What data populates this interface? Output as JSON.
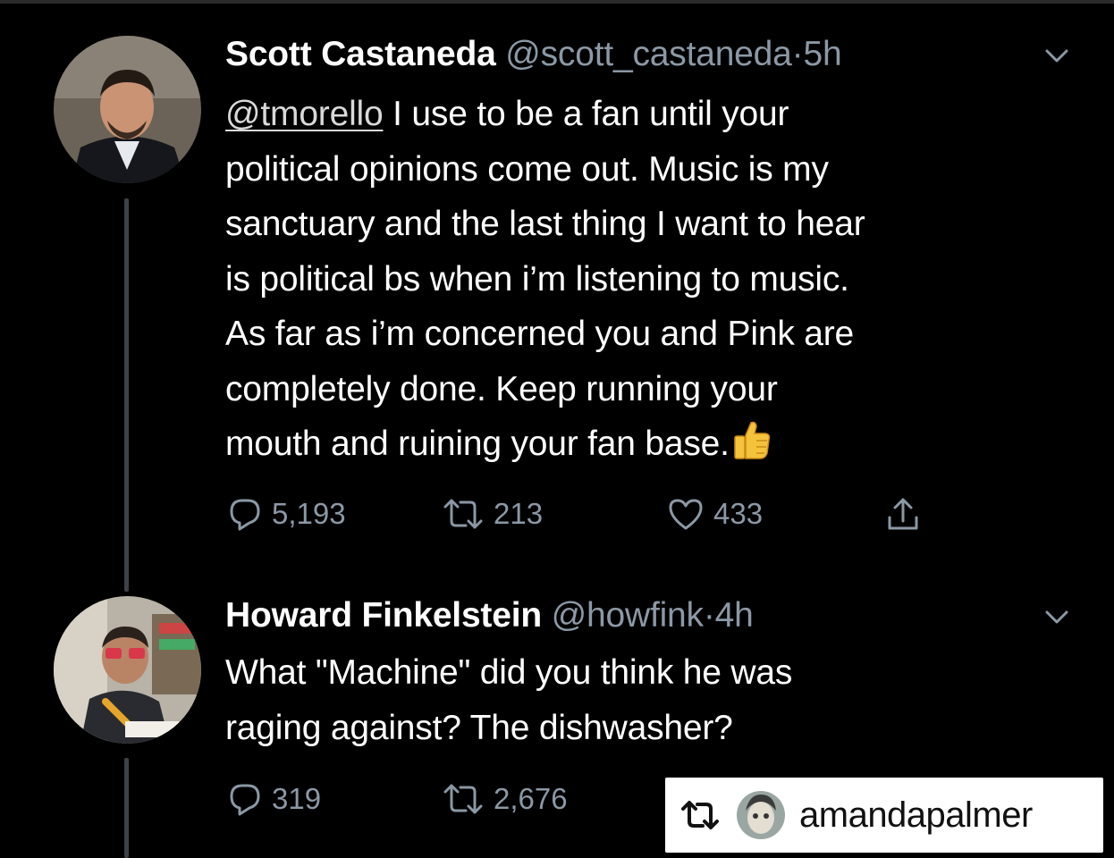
{
  "tweets": [
    {
      "name": "Scott Castaneda",
      "handle": "@scott_castaneda",
      "separator": "·",
      "time": "5h",
      "mention": "@tmorello",
      "text_lines": [
        " I use to be a fan until your",
        "political opinions come out. Music is my",
        "sanctuary and the last thing I want to hear",
        "is political bs when i’m listening to music.",
        "As far as i’m concerned you and Pink are",
        "completely done. Keep running your",
        "mouth and ruining your fan base."
      ],
      "emoji": "thumbs-up",
      "replies": "5,193",
      "retweets": "213",
      "likes": "433"
    },
    {
      "name": "Howard Finkelstein",
      "handle": "@howfink",
      "separator": "·",
      "time": "4h",
      "text_lines": [
        "What \"Machine\" did you think he was",
        "raging against? The dishwasher?"
      ],
      "replies": "319",
      "retweets": "2,676"
    }
  ],
  "repost_badge": {
    "username": "amandapalmer",
    "icon": "repost-icon"
  },
  "icons": {
    "reply": "reply-icon",
    "retweet": "retweet-icon",
    "like": "heart-icon",
    "share": "share-icon",
    "menu": "chevron-down-icon"
  },
  "colors": {
    "background": "#000000",
    "text": "#ffffff",
    "muted": "#8b98a5",
    "thread_line": "#3d4248",
    "badge_bg": "#ffffff"
  }
}
